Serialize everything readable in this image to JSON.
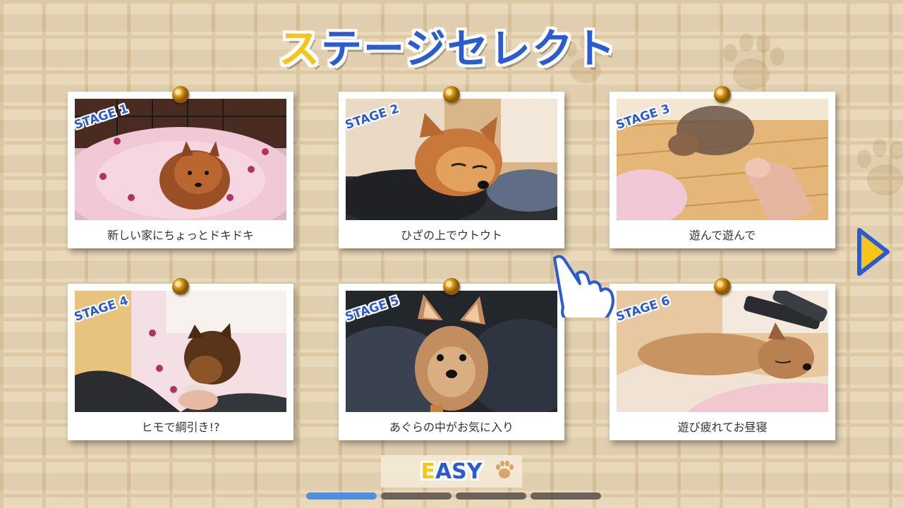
{
  "title": {
    "first_char": "ス",
    "rest": "テージセレクト"
  },
  "stages": [
    {
      "label": "STAGE 1",
      "caption": "新しい家にちょっとドキドキ"
    },
    {
      "label": "STAGE 2",
      "caption": "ひざの上でウトウト"
    },
    {
      "label": "STAGE 3",
      "caption": "遊んで遊んで"
    },
    {
      "label": "STAGE 4",
      "caption": "ヒモで綱引き!?"
    },
    {
      "label": "STAGE 5",
      "caption": "あぐらの中がお気に入り"
    },
    {
      "label": "STAGE 6",
      "caption": "遊び疲れてお昼寝"
    }
  ],
  "difficulty": {
    "first_char": "E",
    "rest": "ASY"
  },
  "pager": {
    "current_page": 1,
    "total_pages": 4
  },
  "colors": {
    "accent_blue": "#2a5bd0",
    "accent_yellow": "#f5c51c",
    "wall": "#e7d5b4"
  },
  "icons": {
    "next": "next-arrow-icon",
    "pointer": "pointing-hand-icon",
    "paw": "paw-icon",
    "pin": "pushpin-icon"
  }
}
